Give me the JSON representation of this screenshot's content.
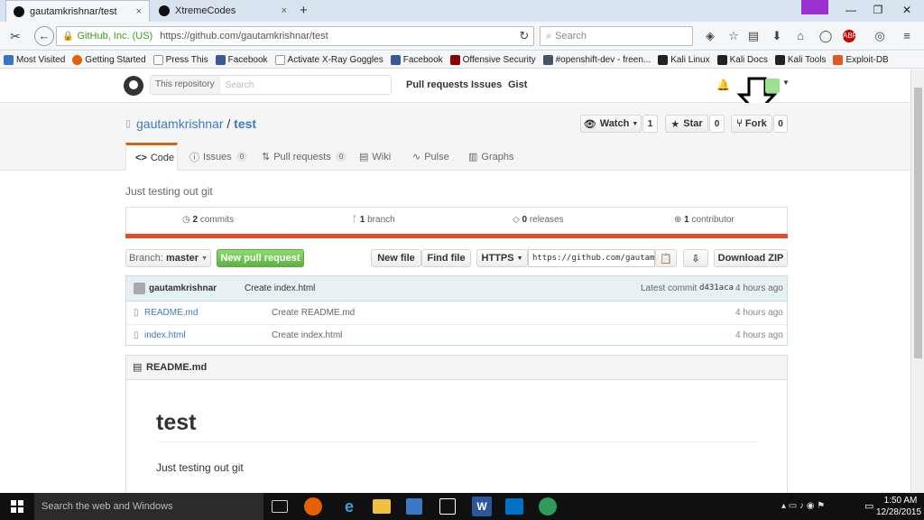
{
  "browser": {
    "tabs": [
      {
        "label": "gautamkrishnar/test",
        "close": "×"
      },
      {
        "label": "XtremeCodes",
        "close": "×"
      }
    ],
    "new_tab": "+",
    "window_controls": {
      "minimize": "—",
      "restore": "❐",
      "close": "✕"
    },
    "identity": "GitHub, Inc. (US)",
    "url": "https://github.com/gautamkrishnar/test",
    "search_placeholder": "Search",
    "bookmarks": [
      {
        "label": "Most Visited",
        "color": "#3b73c9"
      },
      {
        "label": "Getting Started",
        "color": "#e66000"
      },
      {
        "label": "Press This",
        "color": "#ffffff"
      },
      {
        "label": "Facebook",
        "color": "#3b5998"
      },
      {
        "label": "Activate X-Ray Goggles",
        "color": "#ffffff"
      },
      {
        "label": "Facebook",
        "color": "#3b5998"
      },
      {
        "label": "Offensive Security",
        "color": "#8b0000"
      },
      {
        "label": "#openshift-dev - freen...",
        "color": "#445566"
      },
      {
        "label": "Kali Linux",
        "color": "#222222"
      },
      {
        "label": "Kali Docs",
        "color": "#222222"
      },
      {
        "label": "Kali Tools",
        "color": "#222222"
      },
      {
        "label": "Exploit-DB",
        "color": "#e25822"
      }
    ]
  },
  "github": {
    "search_scope": "This repository",
    "search_placeholder": "Search",
    "nav": [
      "Pull requests",
      "Issues",
      "Gist"
    ],
    "owner": "gautamkrishnar",
    "separator": "/",
    "repo": "test",
    "watch_label": "Watch",
    "watch_count": "1",
    "star_label": "Star",
    "star_count": "0",
    "fork_label": "Fork",
    "fork_count": "0",
    "tabs": [
      {
        "label": "Code",
        "badge": ""
      },
      {
        "label": "Issues",
        "badge": "0"
      },
      {
        "label": "Pull requests",
        "badge": "0"
      },
      {
        "label": "Wiki",
        "badge": ""
      },
      {
        "label": "Pulse",
        "badge": ""
      },
      {
        "label": "Graphs",
        "badge": ""
      }
    ],
    "description": "Just testing out git",
    "summary": [
      {
        "num": "2",
        "label": "commits"
      },
      {
        "num": "1",
        "label": "branch"
      },
      {
        "num": "0",
        "label": "releases"
      },
      {
        "num": "1",
        "label": "contributor"
      }
    ],
    "branch_label": "Branch:",
    "branch_name": "master",
    "new_pr": "New pull request",
    "new_file": "New file",
    "find_file": "Find file",
    "clone_protocol": "HTTPS",
    "clone_url": "https://github.com/gautam",
    "download_zip": "Download ZIP",
    "commit": {
      "author": "gautamkrishnar",
      "message": "Create index.html",
      "latest_label": "Latest commit",
      "sha": "d431aca",
      "time": "4 hours ago"
    },
    "files": [
      {
        "name": "README.md",
        "message": "Create README.md",
        "time": "4 hours ago"
      },
      {
        "name": "index.html",
        "message": "Create index.html",
        "time": "4 hours ago"
      }
    ],
    "readme_title": "README.md",
    "readme_heading": "test",
    "readme_body": "Just testing out git"
  },
  "taskbar": {
    "search_placeholder": "Search the web and Windows",
    "time": "1:50 AM",
    "date": "12/28/2015"
  },
  "colors": {
    "accent_orange": "#d26911",
    "green_button": "#6cc644",
    "link_blue": "#4078c0",
    "lang_bar": "#e34c26"
  }
}
